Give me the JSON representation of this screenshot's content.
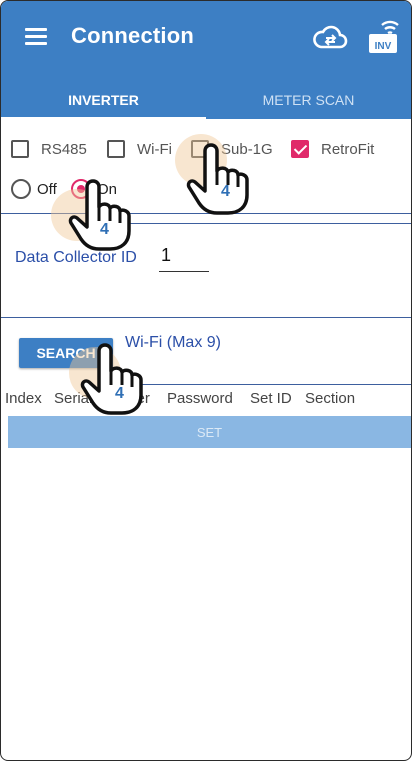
{
  "appbar": {
    "title": "Connection",
    "menu_icon": "hamburger-menu-icon",
    "cloud_icon": "cloud-sync-icon",
    "inverter_icon": "inverter-wifi-icon",
    "inverter_icon_text": "INV"
  },
  "tabs": [
    {
      "label": "INVERTER",
      "selected": true
    },
    {
      "label": "METER SCAN",
      "selected": false
    }
  ],
  "modes": [
    {
      "label": "RS485",
      "checked": false
    },
    {
      "label": "Wi-Fi",
      "checked": false
    },
    {
      "label": "Sub-1G",
      "checked": false
    },
    {
      "label": "RetroFit",
      "checked": true
    }
  ],
  "radio": {
    "off_label": "Off",
    "on_label": "On",
    "selected": "On"
  },
  "data_collector": {
    "label": "Data Collector ID",
    "value": "1"
  },
  "search": {
    "button_label": "SEARCH",
    "wifi_label": "Wi-Fi (Max 9)"
  },
  "table": {
    "columns": [
      "Index",
      "Serial Number",
      "Password",
      "Set ID",
      "Section"
    ]
  },
  "set_button_label": "SET",
  "step_markers": [
    "4",
    "4",
    "4"
  ],
  "colors": {
    "primary": "#3d7fc4",
    "accent": "#e0296a",
    "label_blue": "#2b4fa8"
  }
}
